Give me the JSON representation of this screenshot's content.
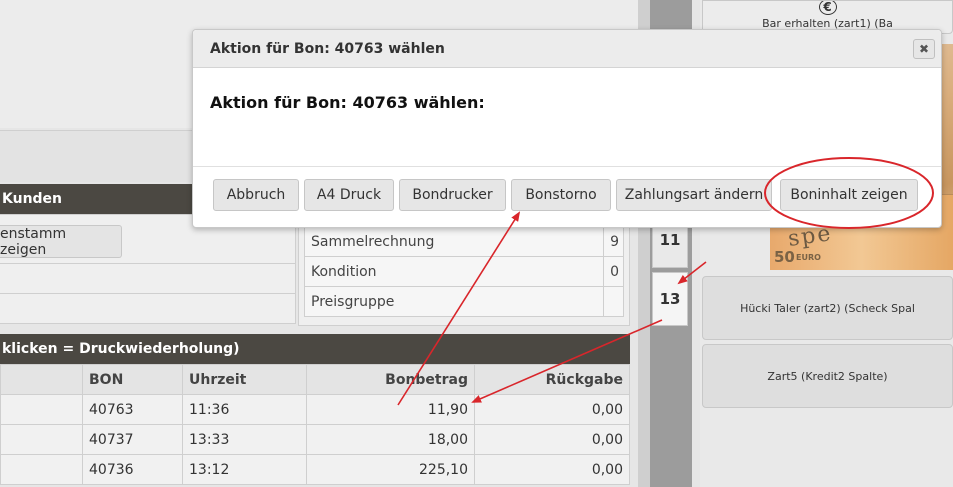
{
  "dialog": {
    "title": "Aktion für Bon: 40763 wählen",
    "body": "Aktion für Bon: 40763 wählen:",
    "close_symbol": "✖",
    "buttons": {
      "abbruch": "Abbruch",
      "a4_druck": "A4 Druck",
      "bondrucker": "Bondrucker",
      "bonstorno": "Bonstorno",
      "zahlungsart": "Zahlungsart ändern",
      "boninhalt": "Boninhalt zeigen"
    }
  },
  "kunden": {
    "header": "Kunden",
    "stamm_button": "enstamm zeigen",
    "info_rows": [
      {
        "label": "Sammelrechnung",
        "value": "9"
      },
      {
        "label": "Kondition",
        "value": "0"
      },
      {
        "label": "Preisgruppe",
        "value": ""
      }
    ]
  },
  "bons": {
    "header": "klicken = Druckwiederholung)",
    "columns": [
      "",
      "BON",
      "Uhrzeit",
      "Bonbetrag",
      "Rückgabe"
    ],
    "rows": [
      {
        "bon": "40763",
        "uhrzeit": "11:36",
        "betrag": "11,90",
        "rueckgabe": "0,00"
      },
      {
        "bon": "40737",
        "uhrzeit": "13:33",
        "betrag": "18,00",
        "rueckgabe": "0,00"
      },
      {
        "bon": "40736",
        "uhrzeit": "13:12",
        "betrag": "225,10",
        "rueckgabe": "0,00"
      }
    ]
  },
  "tabs": {
    "tab_11": "11",
    "tab_13": "13"
  },
  "right_panel": {
    "bar_button": "Bar erhalten (zart1) (Ba",
    "euro_symbol": "€",
    "hucki_button": "Hücki Taler (zart2) (Scheck Spal",
    "zart5_button": "Zart5 (Kredit2 Spalte)",
    "banknote_text": "spe",
    "banknote_value": "50",
    "banknote_currency": "EURO"
  },
  "colors": {
    "header_bg": "#4b4842",
    "annotation_red": "#d9262b"
  }
}
